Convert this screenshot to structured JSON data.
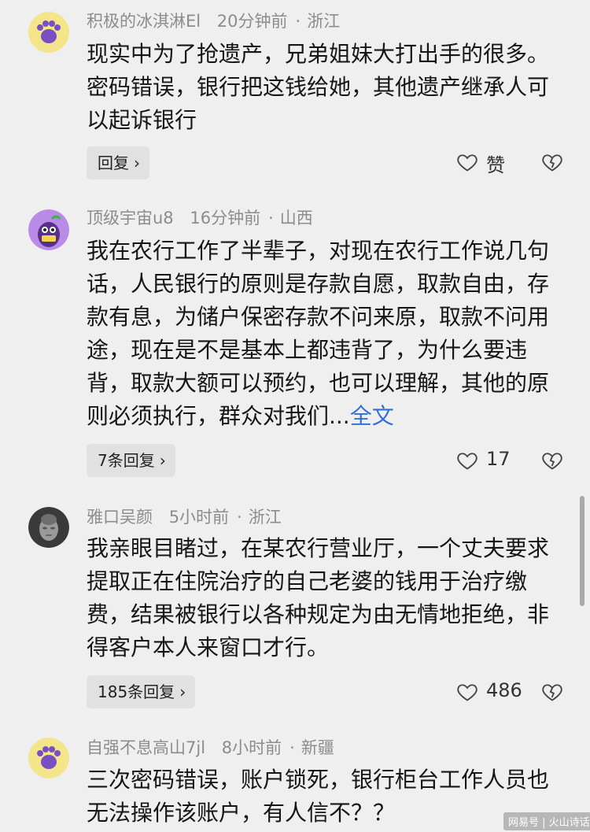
{
  "comments": [
    {
      "username": "积极的冰淇淋El",
      "time": "20分钟前",
      "location": "浙江",
      "text": "现实中为了抢遗产，兄弟姐妹大打出手的很多。密码错误，银行把这钱给她，其他遗产继承人可以起诉银行",
      "more": "",
      "reply_label": "回复",
      "like_label": "赞",
      "avatar": "purple-paw-avatar"
    },
    {
      "username": "顶级宇宙u8",
      "time": "16分钟前",
      "location": "山西",
      "text": "我在农行工作了半辈子，对现在农行工作说几句话，人民银行的原则是存款自愿，取款自由，存款有息，为储户保密存款不问来原，取款不问用途，现在是不是基本上都违背了，为什么要违背，取款大额可以预约，也可以理解，其他的原则必须执行，群众对我们...",
      "more": "全文",
      "reply_label": "7条回复",
      "like_label": "17",
      "avatar": "purple-character-avatar"
    },
    {
      "username": "雅口吴颜",
      "time": "5小时前",
      "location": "浙江",
      "text": "我亲眼目睹过，在某农行营业厅，一个丈夫要求提取正在住院治疗的自己老婆的钱用于治疗缴费，结果被银行以各种规定为由无情地拒绝，非得客户本人来窗口才行。",
      "more": "",
      "reply_label": "185条回复",
      "like_label": "486",
      "avatar": "statue-face-avatar"
    },
    {
      "username": "自强不息高山7jl",
      "time": "8小时前",
      "location": "新疆",
      "text": "三次密码错误，账户锁死，银行柜台工作人员也无法操作该账户，有人信不？？",
      "more": "",
      "avatar": "purple-paw-avatar"
    }
  ],
  "ui": {
    "separator": "·",
    "chevron": "›",
    "watermark": "网易号 | 火山诗话"
  },
  "colors": {
    "background": "#efefef",
    "meta_text": "#8c8c8c",
    "body_text": "#161616",
    "link": "#2f6fd6",
    "reply_bg": "#e1e1e1"
  }
}
